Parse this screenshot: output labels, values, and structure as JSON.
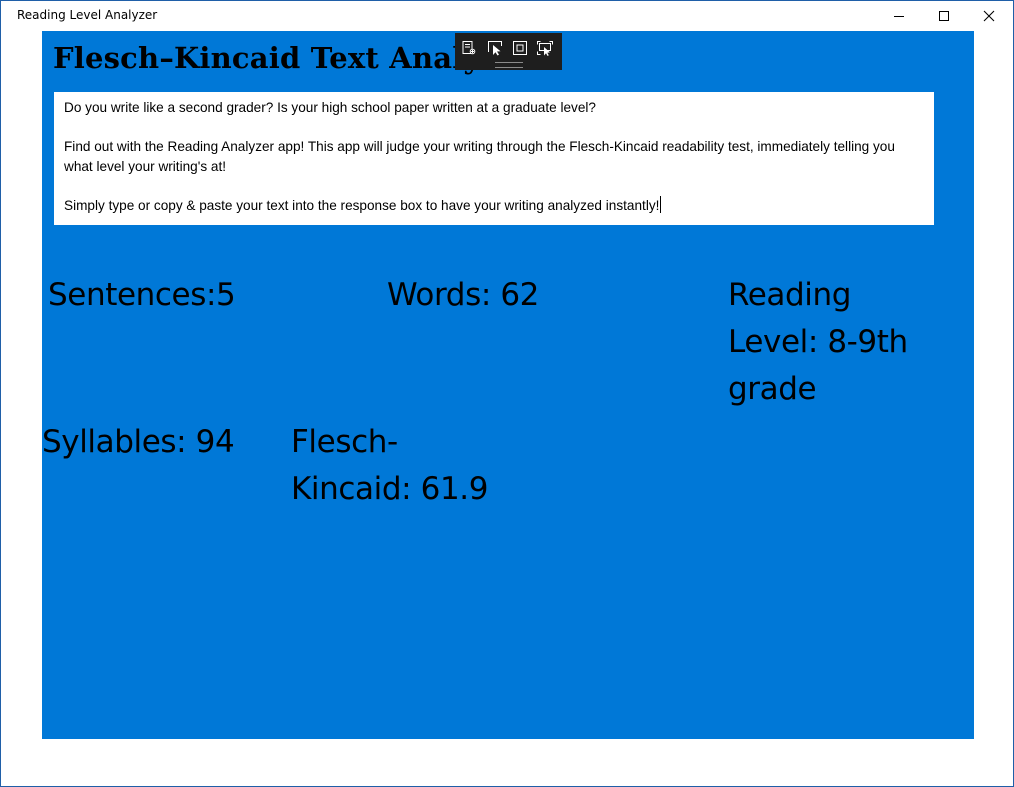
{
  "window": {
    "title": "Reading Level Analyzer",
    "controls": [
      "minimize-icon",
      "maximize-icon",
      "close-icon"
    ]
  },
  "app": {
    "heading": "Flesch–Kincaid Text Analyzer",
    "background_color": "#0078d7",
    "text_color": "#000000"
  },
  "debug_toolbar": {
    "buttons": [
      "live-visual-tree-icon",
      "select-element-icon",
      "display-layout-adorners-icon",
      "track-focused-element-icon"
    ]
  },
  "input_text": {
    "paragraphs": [
      "Do you write like a second grader?  Is your high school paper written at a graduate level?",
      "Find out with the Reading Analyzer app! This app will judge your writing through the Flesch-Kincaid readability test, immediately telling you what level your writing's at!",
      "Simply type or copy & paste your text into the response box to have your writing analyzed instantly!"
    ]
  },
  "stats": {
    "sentences": "Sentences:5",
    "words": "Words: 62",
    "reading_level": "Reading Level: 8-9th grade",
    "syllables": "Syllables: 94",
    "flesch_kincaid": "Flesch-Kincaid: 61.9"
  }
}
